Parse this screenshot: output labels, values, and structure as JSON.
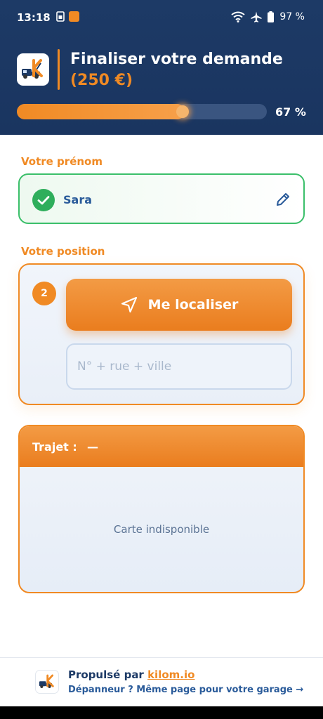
{
  "status_bar": {
    "time": "13:18",
    "battery_percent": "97 %",
    "icons": [
      "sim-icon",
      "app-notification-icon",
      "wifi-icon",
      "airplane-icon",
      "battery-icon"
    ]
  },
  "header": {
    "title": "Finaliser votre demande",
    "price": "(250 €)",
    "progress_fraction": 0.67,
    "progress_label": "67 %"
  },
  "form": {
    "firstname_label": "Votre prénom",
    "firstname_value": "Sara",
    "position_label": "Votre position",
    "step_number": "2",
    "locate_button_label": "Me localiser",
    "address_placeholder": "N° + rue + ville"
  },
  "route": {
    "label": "Trajet :",
    "value": "—",
    "map_message": "Carte indisponible"
  },
  "footer": {
    "powered_prefix": "Propulsé par",
    "powered_link": "kilom.io",
    "garage_text": "Dépanneur ? Même page pour votre garage →"
  },
  "colors": {
    "header_bg": "#1d3a66",
    "accent_orange": "#f08a24",
    "success_green": "#3bbf6a",
    "link_blue": "#2a5b9a"
  }
}
